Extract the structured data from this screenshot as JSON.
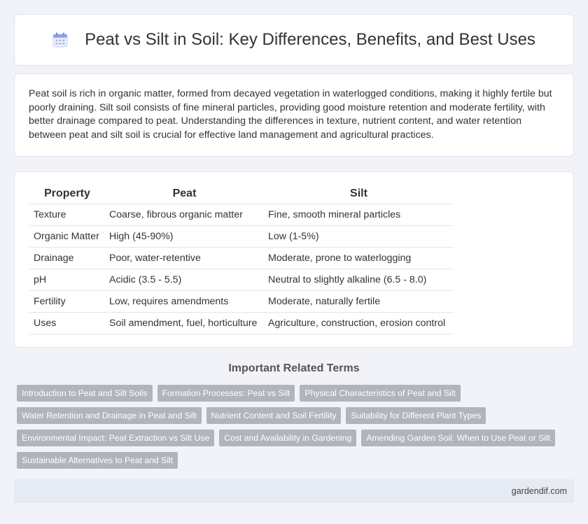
{
  "header": {
    "title": "Peat vs Silt in Soil: Key Differences, Benefits, and Best Uses",
    "icon": "calendar-icon"
  },
  "intro": {
    "text": "Peat soil is rich in organic matter, formed from decayed vegetation in waterlogged conditions, making it highly fertile but poorly draining. Silt soil consists of fine mineral particles, providing good moisture retention and moderate fertility, with better drainage compared to peat. Understanding the differences in texture, nutrient content, and water retention between peat and silt soil is crucial for effective land management and agricultural practices."
  },
  "comparison": {
    "headers": [
      "Property",
      "Peat",
      "Silt"
    ],
    "rows": [
      [
        "Texture",
        "Coarse, fibrous organic matter",
        "Fine, smooth mineral particles"
      ],
      [
        "Organic Matter",
        "High (45-90%)",
        "Low (1-5%)"
      ],
      [
        "Drainage",
        "Poor, water-retentive",
        "Moderate, prone to waterlogging"
      ],
      [
        "pH",
        "Acidic (3.5 - 5.5)",
        "Neutral to slightly alkaline (6.5 - 8.0)"
      ],
      [
        "Fertility",
        "Low, requires amendments",
        "Moderate, naturally fertile"
      ],
      [
        "Uses",
        "Soil amendment, fuel, horticulture",
        "Agriculture, construction, erosion control"
      ]
    ]
  },
  "related": {
    "title": "Important Related Terms",
    "rows": [
      [
        "Introduction to Peat and Silt Soils",
        "Formation Processes: Peat vs Silt",
        "Physical Characteristics of Peat and Silt"
      ],
      [
        "Water Retention and Drainage in Peat and Silt",
        "Nutrient Content and Soil Fertility",
        "Suitability for Different Plant Types"
      ],
      [
        "Environmental Impact: Peat Extraction vs Silt Use",
        "Cost and Availability in Gardening",
        "Amending Garden Soil: When to Use Peat or Silt"
      ],
      [
        "Sustainable Alternatives to Peat and Silt"
      ]
    ]
  },
  "footer": {
    "site": "gardendif.com"
  },
  "colors": {
    "background": "#f1f3f8",
    "tag": "#b0b5bc",
    "footer": "#e6eaf2",
    "icon_accent": "#7b8ff0"
  }
}
